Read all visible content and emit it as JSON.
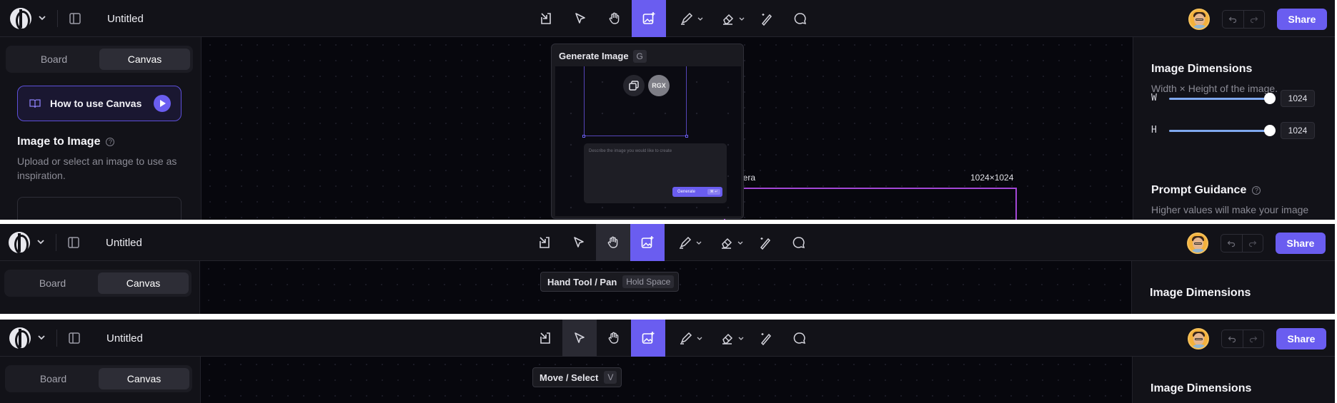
{
  "app": {
    "doc_title": "Untitled",
    "share_label": "Share"
  },
  "left": {
    "tabs": [
      "Board",
      "Canvas"
    ],
    "howto_label": "How to use Canvas",
    "i2i_title": "Image to Image",
    "i2i_help": "?",
    "i2i_desc": "Upload or select an image to use as inspiration."
  },
  "canvas": {
    "frame_label_left": "Genera",
    "frame_label_right": "1024×1024"
  },
  "popover": {
    "title": "Generate Image",
    "shortcut": "G",
    "rgx_label": "RGX",
    "prompt_placeholder": "Describe the image you would like to create",
    "generate_label": "Generate",
    "generate_kbd": "⌘ ↵"
  },
  "right": {
    "dims_title": "Image Dimensions",
    "dims_desc": "Width × Height of the image.",
    "w_label": "W",
    "w_value": "1024",
    "h_label": "H",
    "h_value": "1024",
    "guidance_title": "Prompt Guidance",
    "guidance_help": "?",
    "guidance_desc": "Higher values will make your image"
  },
  "tooltips": {
    "hand_label": "Hand Tool / Pan",
    "hand_key": "Hold Space",
    "move_label": "Move / Select",
    "move_key": "V"
  },
  "icons": [
    "logo-icon",
    "chevron-down-icon",
    "sidebar-toggle-icon",
    "import-icon",
    "cursor-icon",
    "hand-icon",
    "generate-image-icon",
    "pen-icon",
    "eraser-icon",
    "magic-wand-icon",
    "comment-icon",
    "undo-icon",
    "redo-icon",
    "book-icon",
    "play-icon",
    "copy-icon"
  ],
  "colors": {
    "accent": "#6a5df0",
    "frame": "#a347d6",
    "background": "#07070d",
    "panel": "#121218"
  }
}
